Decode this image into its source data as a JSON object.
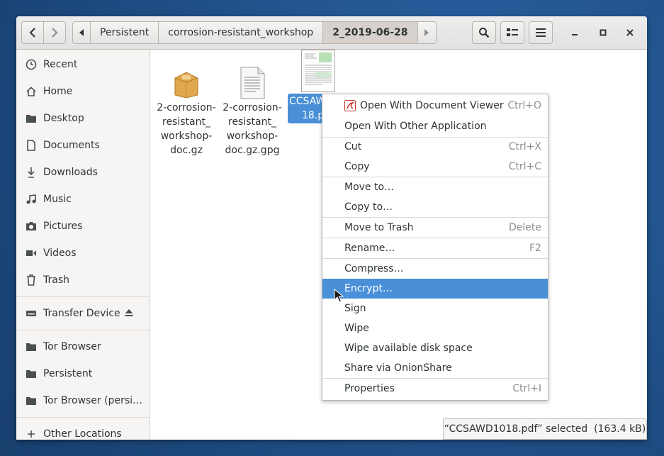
{
  "headerbar": {
    "path": [
      "Persistent",
      "corrosion-resistant_workshop",
      "2_2019-06-28"
    ],
    "current_index": 2
  },
  "sidebar": {
    "places": [
      {
        "label": "Recent",
        "icon": "clock-icon"
      },
      {
        "label": "Home",
        "icon": "home-icon"
      },
      {
        "label": "Desktop",
        "icon": "folder-icon"
      },
      {
        "label": "Documents",
        "icon": "document-icon"
      },
      {
        "label": "Downloads",
        "icon": "download-icon"
      },
      {
        "label": "Music",
        "icon": "music-icon"
      },
      {
        "label": "Pictures",
        "icon": "camera-icon"
      },
      {
        "label": "Videos",
        "icon": "video-icon"
      },
      {
        "label": "Trash",
        "icon": "trash-icon"
      }
    ],
    "devices": [
      {
        "label": "Transfer Device",
        "icon": "drive-icon"
      }
    ],
    "bookmarks": [
      {
        "label": "Tor Browser",
        "icon": "folder-icon"
      },
      {
        "label": "Persistent",
        "icon": "folder-icon"
      },
      {
        "label": "Tor Browser (persi…",
        "icon": "folder-icon"
      }
    ],
    "other": {
      "label": "Other Locations",
      "icon": "plus-icon"
    }
  },
  "files": [
    {
      "name": "2-corrosion-resistant_workshop-doc.gz",
      "display_lines": [
        "2-corrosion-",
        "resistant_",
        "workshop-",
        "doc.gz"
      ],
      "icon": "archive-icon"
    },
    {
      "name": "2-corrosion-resistant_workshop-doc.gz.gpg",
      "display_lines": [
        "2-corrosion-",
        "resistant_",
        "workshop-",
        "doc.gz.gpg"
      ],
      "icon": "text-file-icon"
    },
    {
      "name": "CCSAWD1018.pdf",
      "display_lines": [
        "CCSAW",
        "18.p"
      ],
      "icon": "pdf-thumbnail-icon",
      "selected": true
    }
  ],
  "context_menu": {
    "items": [
      {
        "label": "Open With Document Viewer",
        "accel": "Ctrl+O",
        "icon": "document-viewer-icon"
      },
      {
        "label": "Open With Other Application",
        "accel": ""
      },
      {
        "sep": true
      },
      {
        "label": "Cut",
        "accel": "Ctrl+X"
      },
      {
        "label": "Copy",
        "accel": "Ctrl+C"
      },
      {
        "sep": true
      },
      {
        "label": "Move to…",
        "accel": ""
      },
      {
        "label": "Copy to…",
        "accel": ""
      },
      {
        "sep": true
      },
      {
        "label": "Move to Trash",
        "accel": "Delete"
      },
      {
        "sep": true
      },
      {
        "label": "Rename…",
        "accel": "F2"
      },
      {
        "sep": true
      },
      {
        "label": "Compress…",
        "accel": ""
      },
      {
        "label": "Encrypt…",
        "accel": "",
        "highlighted": true
      },
      {
        "label": "Sign",
        "accel": ""
      },
      {
        "label": "Wipe",
        "accel": ""
      },
      {
        "label": "Wipe available disk space",
        "accel": ""
      },
      {
        "label": "Share via OnionShare",
        "accel": ""
      },
      {
        "sep": true
      },
      {
        "label": "Properties",
        "accel": "Ctrl+I"
      }
    ]
  },
  "status": {
    "text": "“CCSAWD1018.pdf” selected  (163.4 kB)"
  },
  "colors": {
    "accent": "#4a90d9",
    "desktop": "#1f4e86"
  }
}
